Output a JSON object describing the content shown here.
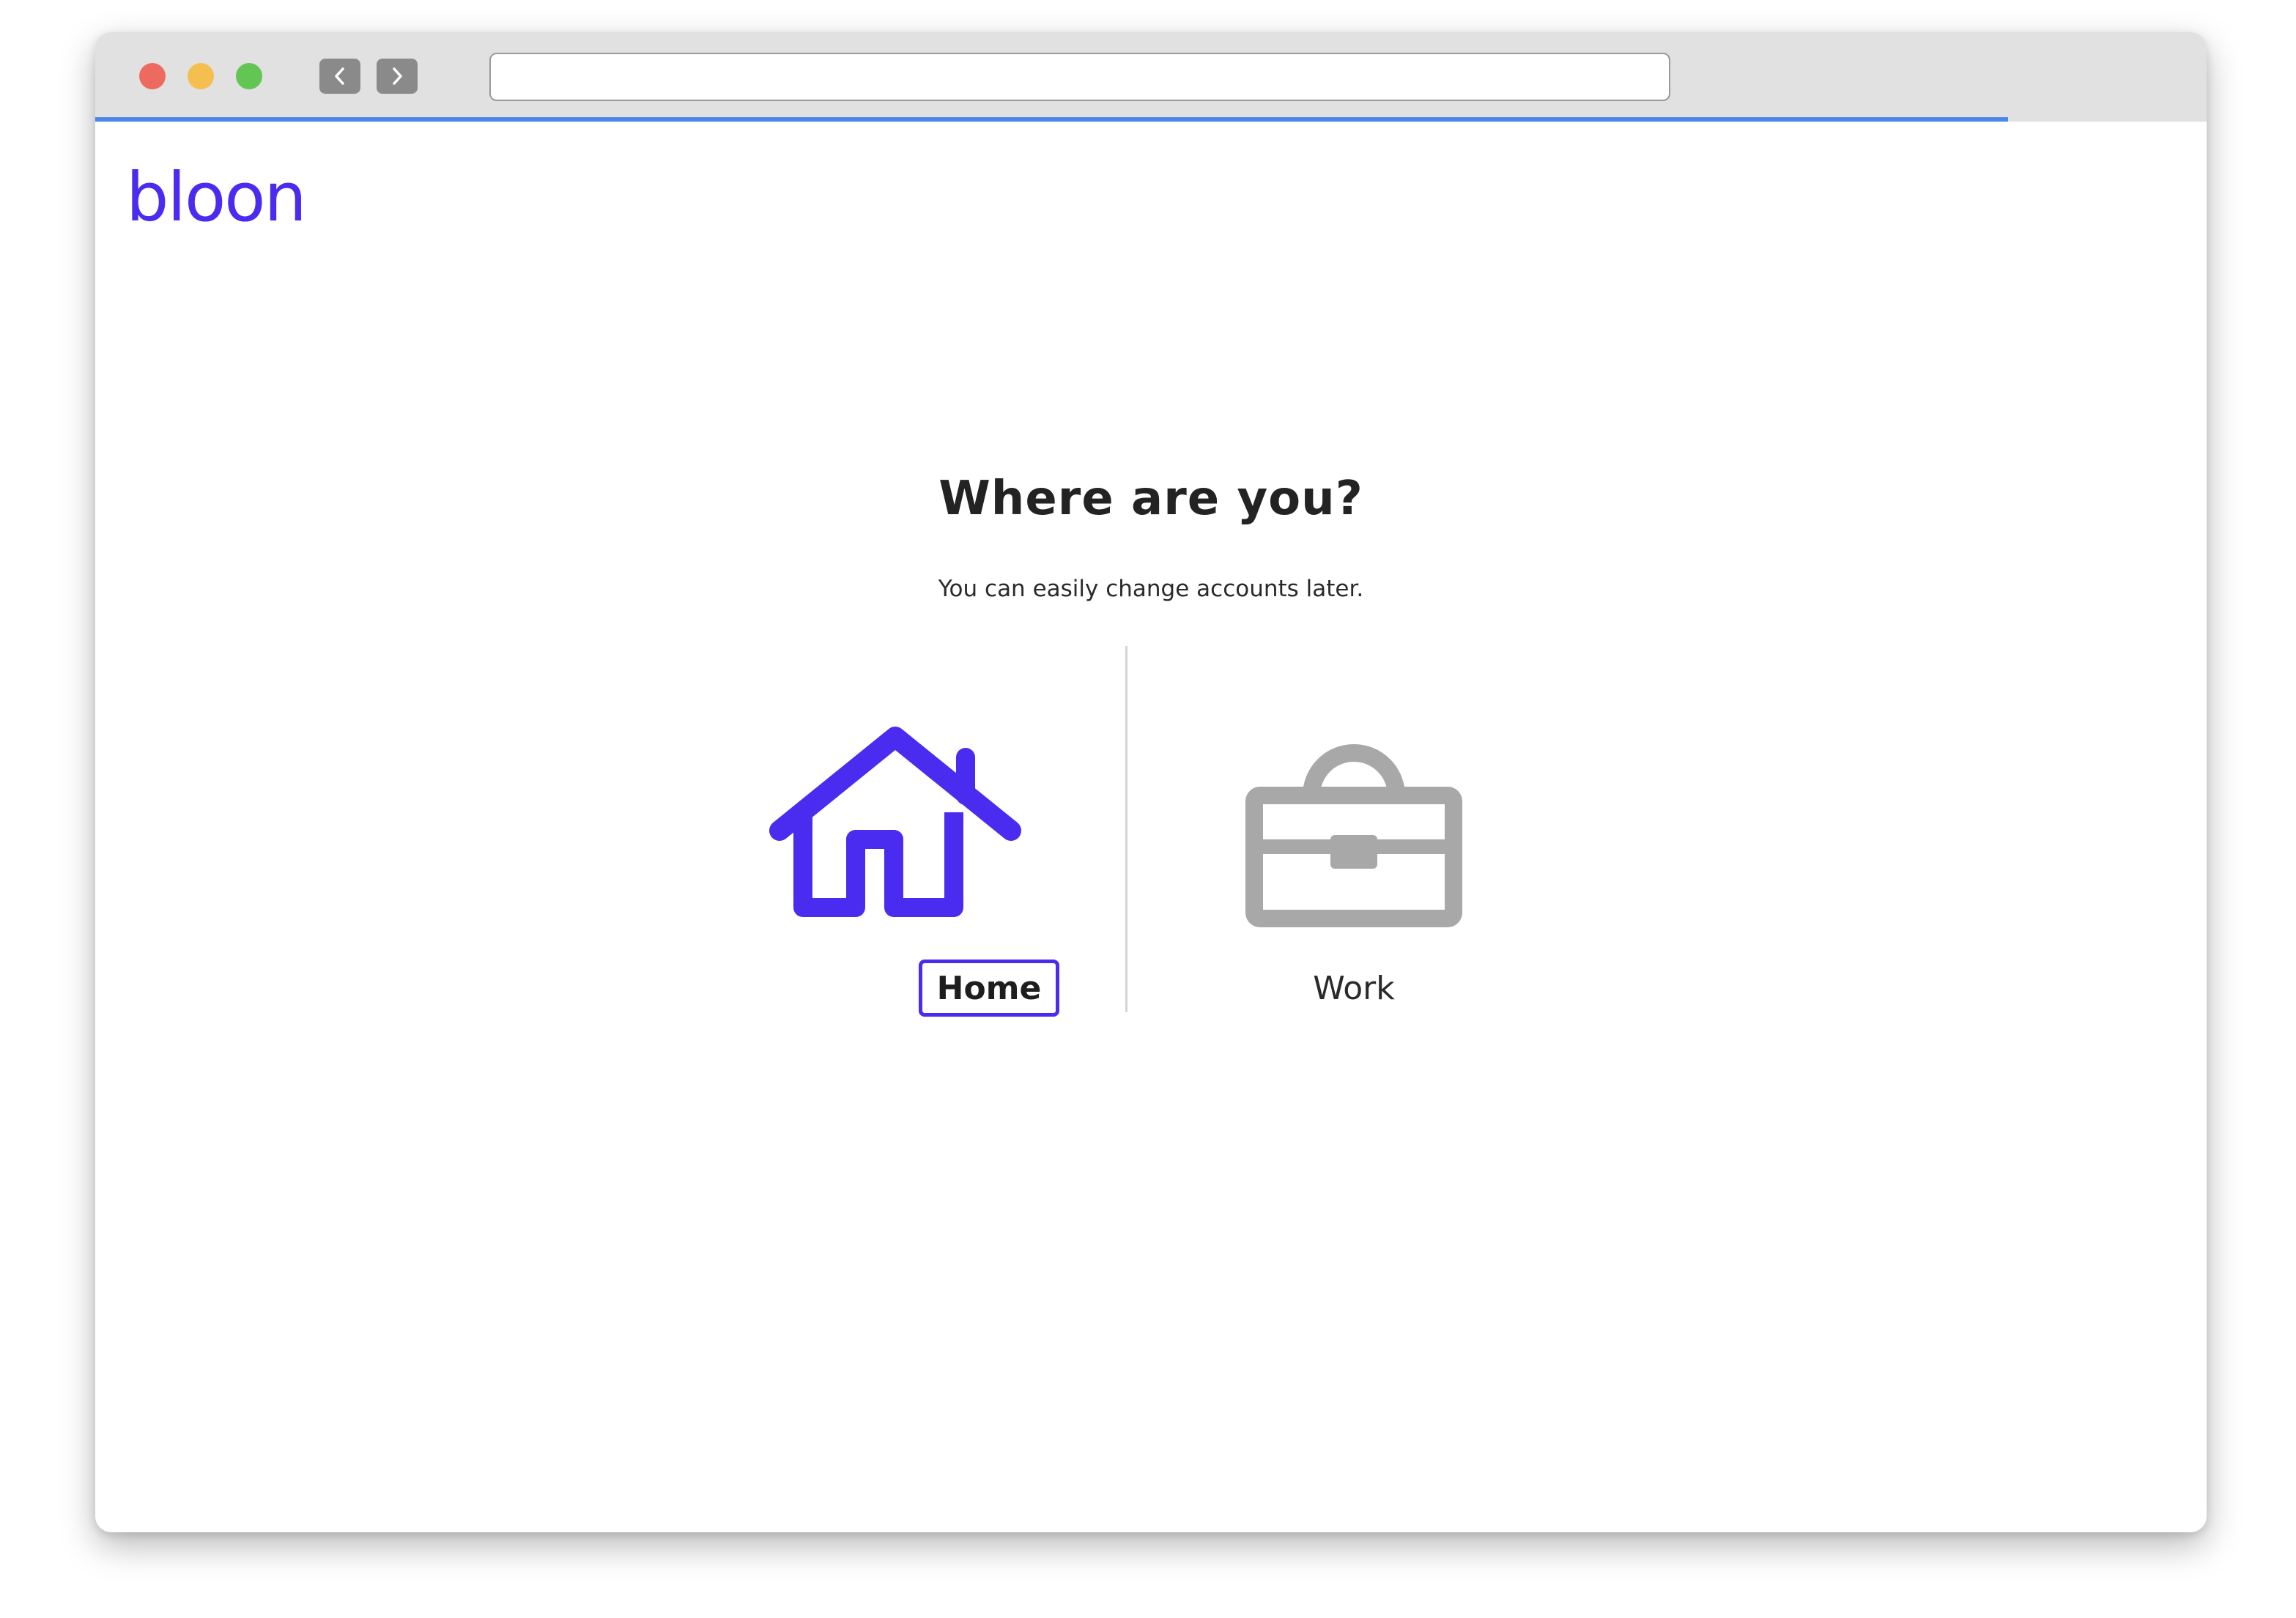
{
  "browser": {
    "address_value": "",
    "load_progress": 0.906,
    "colors": {
      "close": "#ed6a5e",
      "minimize": "#f5bf4f",
      "zoom": "#62c554",
      "progress": "#4a86e8"
    }
  },
  "app": {
    "logo": "bloon",
    "brand_color": "#4a2cf0"
  },
  "main": {
    "title": "Where are you?",
    "subtitle": "You can easily change accounts later.",
    "options": [
      {
        "label": "Home",
        "icon": "house-icon",
        "selected": true
      },
      {
        "label": "Work",
        "icon": "briefcase-icon",
        "selected": false
      }
    ]
  }
}
